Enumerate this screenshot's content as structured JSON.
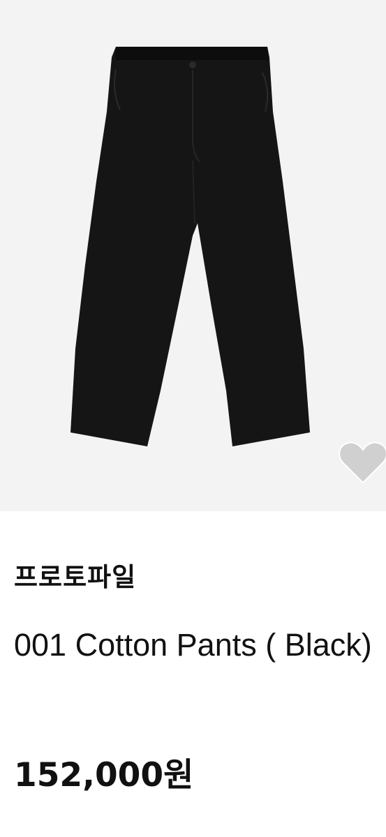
{
  "product": {
    "image_alt": "black cotton pants",
    "brand": "프로토파일",
    "title": "001 Cotton Pants ( Black)",
    "price": "152,000원",
    "wishlist_icon": "heart-icon"
  },
  "colors": {
    "image_background": "#f3f3f3",
    "pants": "#151515",
    "heart": "#d0d0d0",
    "text": "#111111"
  }
}
